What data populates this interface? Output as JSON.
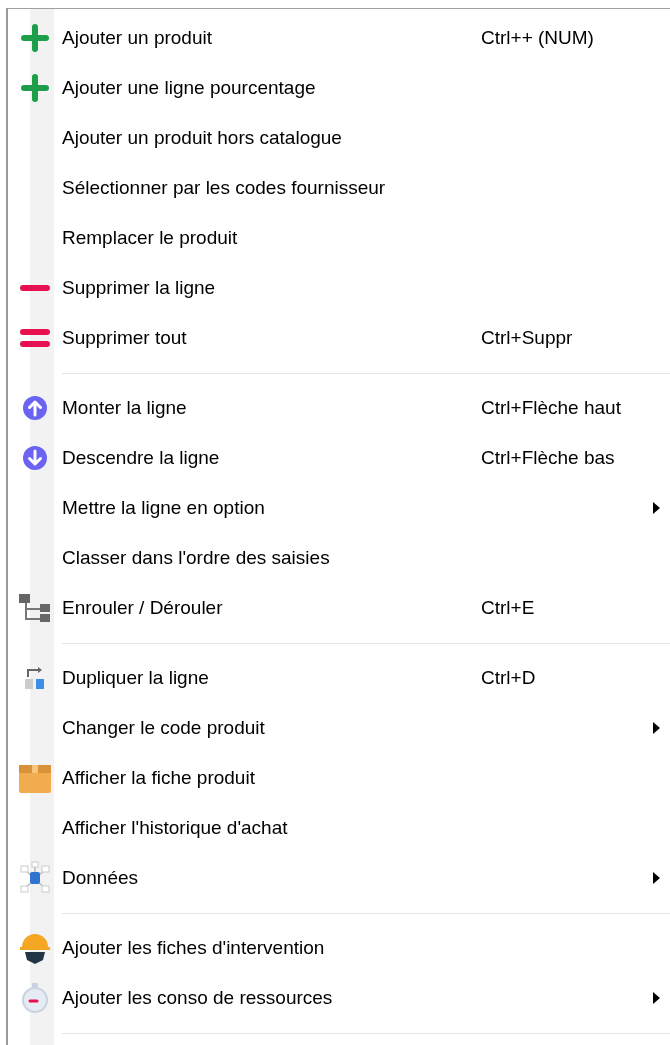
{
  "menu": {
    "groups": [
      {
        "items": [
          {
            "label": "Ajouter un produit",
            "shortcut": "Ctrl++ (NUM)",
            "submenu": false
          },
          {
            "label": "Ajouter une ligne pourcentage",
            "submenu": false
          },
          {
            "label": "Ajouter un produit hors catalogue",
            "submenu": false
          },
          {
            "label": "Sélectionner par les codes fournisseur",
            "submenu": false
          },
          {
            "label": "Remplacer le produit",
            "submenu": false
          },
          {
            "label": "Supprimer la ligne",
            "submenu": false
          },
          {
            "label": "Supprimer tout",
            "shortcut": "Ctrl+Suppr",
            "submenu": false
          }
        ]
      },
      {
        "items": [
          {
            "label": "Monter la ligne",
            "shortcut": "Ctrl+Flèche haut",
            "submenu": false
          },
          {
            "label": "Descendre la ligne",
            "shortcut": "Ctrl+Flèche bas",
            "submenu": false
          },
          {
            "label": "Mettre la ligne en option",
            "submenu": true
          },
          {
            "label": "Classer dans l'ordre des saisies",
            "submenu": false
          },
          {
            "label": "Enrouler / Dérouler",
            "shortcut": "Ctrl+E",
            "submenu": false
          }
        ]
      },
      {
        "items": [
          {
            "label": "Dupliquer la ligne",
            "shortcut": "Ctrl+D",
            "submenu": false
          },
          {
            "label": "Changer le code produit",
            "submenu": true
          },
          {
            "label": "Afficher la fiche produit",
            "submenu": false
          },
          {
            "label": "Afficher l'historique d'achat",
            "submenu": false
          },
          {
            "label": "Données",
            "submenu": true
          }
        ]
      },
      {
        "items": [
          {
            "label": "Ajouter les fiches d'intervention",
            "submenu": false
          },
          {
            "label": "Ajouter les conso de ressources",
            "submenu": true
          }
        ]
      }
    ]
  }
}
